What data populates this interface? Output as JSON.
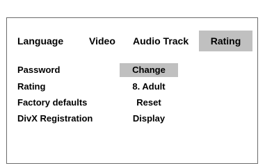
{
  "tabs": {
    "language": "Language",
    "video": "Video",
    "audio_track": "Audio Track",
    "rating": "Rating",
    "selected": "Rating"
  },
  "settings": [
    {
      "label": "Password",
      "value": "Change",
      "selected": true
    },
    {
      "label": "Rating",
      "value": "8. Adult",
      "selected": false
    },
    {
      "label": "Factory defaults",
      "value": "Reset",
      "selected": false
    },
    {
      "label": "DivX Registration",
      "value": "Display",
      "selected": false
    }
  ],
  "colors": {
    "highlight": "#c0c0c0",
    "border": "#6b6b6b",
    "background": "#ffffff",
    "text": "#000000"
  }
}
